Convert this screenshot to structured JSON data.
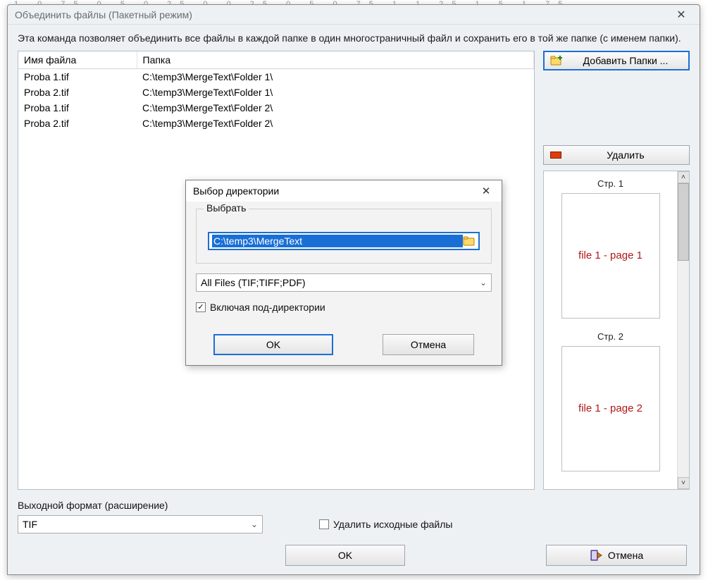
{
  "ruler_text": "1 0.75 0.5 0.25 0 0.25 0.5 0.75 1 1.25 1.5 1.75",
  "window": {
    "title": "Объединить файлы (Пакетный режим)",
    "description": "Эта команда позволяет объединить все файлы в каждой папке в один многостраничный файл и сохранить его в той же папке (с именем папки)."
  },
  "table": {
    "headers": {
      "name": "Имя файла",
      "folder": "Папка"
    },
    "rows": [
      {
        "name": "Proba 1.tif",
        "folder": "C:\\temp3\\MergeText\\Folder 1\\"
      },
      {
        "name": "Proba 2.tif",
        "folder": "C:\\temp3\\MergeText\\Folder 1\\"
      },
      {
        "name": "Proba 1.tif",
        "folder": "C:\\temp3\\MergeText\\Folder 2\\"
      },
      {
        "name": "Proba 2.tif",
        "folder": "C:\\temp3\\MergeText\\Folder 2\\"
      }
    ]
  },
  "side": {
    "add_folders": "Добавить Папки ...",
    "delete": "Удалить",
    "preview": {
      "pages": [
        {
          "label": "Стр. 1",
          "content": "file 1 - page 1"
        },
        {
          "label": "Стр. 2",
          "content": "file 1 - page 2"
        }
      ]
    }
  },
  "bottom": {
    "output_label": "Выходной формат (расширение)",
    "output_value": "TIF",
    "delete_source": "Удалить исходные файлы",
    "ok": "OK",
    "cancel": "Отмена"
  },
  "modal": {
    "title": "Выбор директории",
    "group_legend": "Выбрать",
    "path": "C:\\temp3\\MergeText",
    "filter": "All Files (TIF;TIFF;PDF)",
    "include_sub": "Включая под-директории",
    "ok": "OK",
    "cancel": "Отмена"
  }
}
